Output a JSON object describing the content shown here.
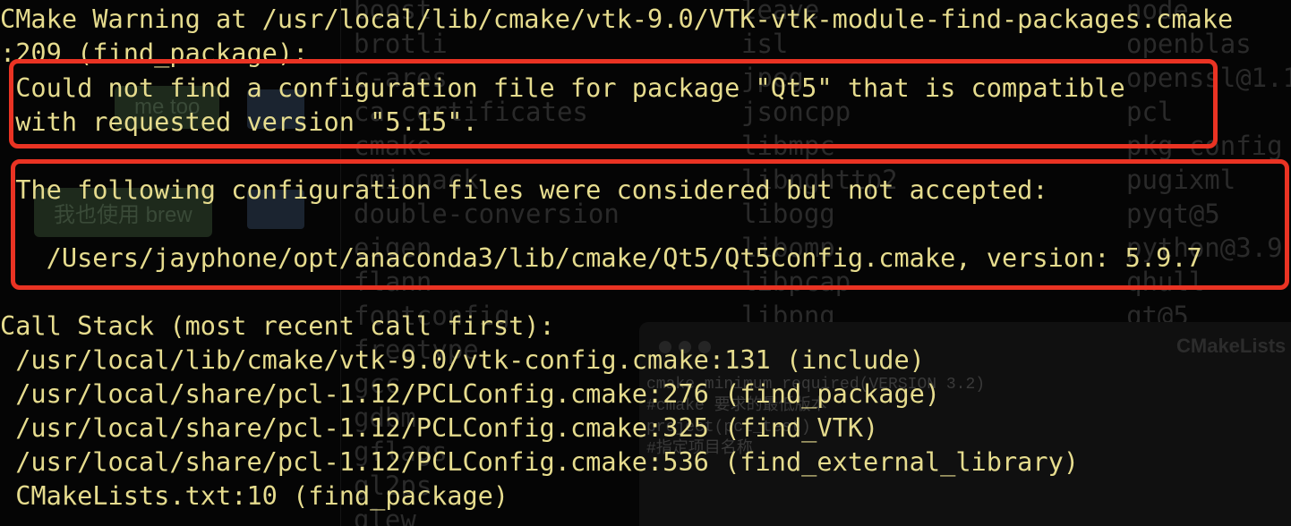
{
  "terminal": {
    "warning_line_1": "CMake Warning at /usr/local/lib/cmake/vtk-9.0/VTK-vtk-module-find-packages.cmake",
    "warning_line_2": ":209 (find_package):",
    "box1_line_1": " Could not find a configuration file for package \"Qt5\" that is compatible",
    "box1_line_2": " with requested version \"5.15\".",
    "box2_line_1": " The following configuration files were considered but not accepted:",
    "box2_line_2": "   /Users/jayphone/opt/anaconda3/lib/cmake/Qt5/Qt5Config.cmake, version: 5.9.7",
    "call_stack_header": "Call Stack (most recent call first):",
    "call_stack": [
      " /usr/local/lib/cmake/vtk-9.0/vtk-config.cmake:131 (include)",
      " /usr/local/share/pcl-1.12/PCLConfig.cmake:276 (find_package)",
      " /usr/local/share/pcl-1.12/PCLConfig.cmake:325 (find_VTK)",
      " /usr/local/share/pcl-1.12/PCLConfig.cmake:536 (find_external_library)",
      " CMakeLists.txt:10 (find_package)"
    ]
  },
  "background": {
    "ghost_col1": "boost\nbrotli\nc-ares\nca-certificates\ncmake\ncminpack\ndouble-conversion\neigen\nflann\nfontconfig\nfreetype\ngcc\ngdbm\ngflags\ngl2ps\nglew",
    "ghost_col2": "leave\nisl\njpeg\njsoncpp\nlibmpc\nlibnghttp2\nlibogg\nlibomp\nlibpcap\nlibpng",
    "ghost_col3": "node\nopenblas\nopenssl@1.1\npcl\npkg-config\npugixml\npyqt@5\npython@3.9\nqhull\nqt@5",
    "button_me_too": "me too",
    "button_brew": "我也使用 brew",
    "window_title": "CMakeLists",
    "window_code": "cmake_minimum_required(VERSION 3.2)\n#cmake 要求的最低版本\nproject(pcl_test)\n#指定项目名称"
  },
  "colors": {
    "text": "#e6dc8e",
    "highlight": "#ea3323",
    "background": "#050505"
  }
}
